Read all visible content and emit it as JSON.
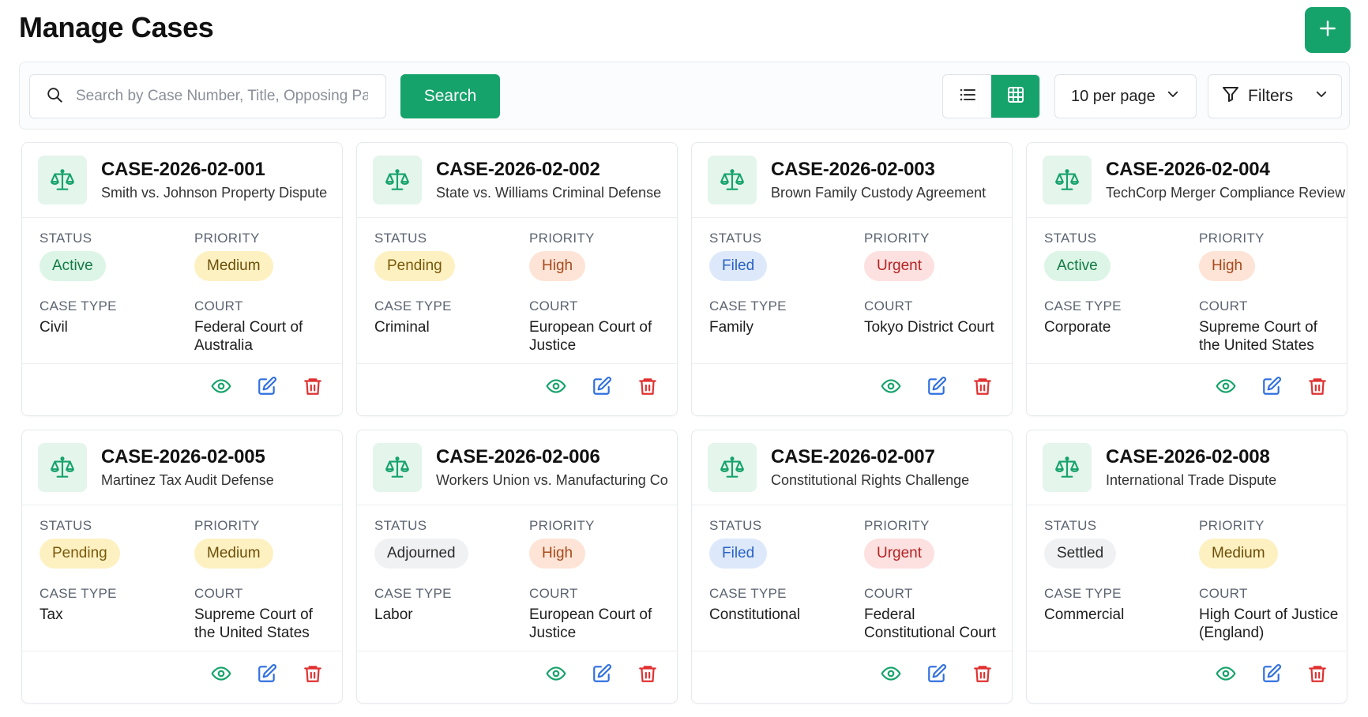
{
  "header": {
    "title": "Manage Cases",
    "add_icon": "plus-icon"
  },
  "toolbar": {
    "search_placeholder": "Search by Case Number, Title, Opposing Pa...",
    "search_label": "Search",
    "view_modes": [
      "list",
      "grid"
    ],
    "active_view": "grid",
    "per_page": "10 per page",
    "filters_label": "Filters"
  },
  "labels": {
    "status": "STATUS",
    "priority": "PRIORITY",
    "case_type": "CASE TYPE",
    "court": "COURT"
  },
  "badge_colors": {
    "Active": {
      "bg": "#dcf5e6",
      "fg": "#137a45"
    },
    "Pending": {
      "bg": "#fdf1c2",
      "fg": "#7a5a0a"
    },
    "Filed": {
      "bg": "#dde9fb",
      "fg": "#2a62c4"
    },
    "Adjourned": {
      "bg": "#f0f1f3",
      "fg": "#2b2b2b"
    },
    "Settled": {
      "bg": "#f0f1f3",
      "fg": "#2b2b2b"
    },
    "Medium": {
      "bg": "#fdf1c2",
      "fg": "#6b4e08"
    },
    "High": {
      "bg": "#fde4d6",
      "fg": "#a84a1c"
    },
    "Urgent": {
      "bg": "#fde0e0",
      "fg": "#b42323"
    }
  },
  "cases": [
    {
      "number": "CASE-2026-02-001",
      "title": "Smith vs. Johnson Property Dispute",
      "status": "Active",
      "priority": "Medium",
      "case_type": "Civil",
      "court": "Federal Court of Australia"
    },
    {
      "number": "CASE-2026-02-002",
      "title": "State vs. Williams Criminal Defense",
      "status": "Pending",
      "priority": "High",
      "case_type": "Criminal",
      "court": "European Court of Justice"
    },
    {
      "number": "CASE-2026-02-003",
      "title": "Brown Family Custody Agreement",
      "status": "Filed",
      "priority": "Urgent",
      "case_type": "Family",
      "court": "Tokyo District Court"
    },
    {
      "number": "CASE-2026-02-004",
      "title": "TechCorp Merger Compliance Review",
      "status": "Active",
      "priority": "High",
      "case_type": "Corporate",
      "court": "Supreme Court of the United States"
    },
    {
      "number": "CASE-2026-02-005",
      "title": "Martinez Tax Audit Defense",
      "status": "Pending",
      "priority": "Medium",
      "case_type": "Tax",
      "court": "Supreme Court of the United States"
    },
    {
      "number": "CASE-2026-02-006",
      "title": "Workers Union vs. Manufacturing Co",
      "status": "Adjourned",
      "priority": "High",
      "case_type": "Labor",
      "court": "European Court of Justice"
    },
    {
      "number": "CASE-2026-02-007",
      "title": "Constitutional Rights Challenge",
      "status": "Filed",
      "priority": "Urgent",
      "case_type": "Constitutional",
      "court": "Federal Constitutional Court"
    },
    {
      "number": "CASE-2026-02-008",
      "title": "International Trade Dispute",
      "status": "Settled",
      "priority": "Medium",
      "case_type": "Commercial",
      "court": "High Court of Justice (England)"
    }
  ],
  "card_icons": {
    "case": "scales-icon",
    "view": "eye-icon",
    "edit": "edit-icon",
    "delete": "trash-icon"
  },
  "colors": {
    "accent": "#16a36b",
    "view": "#16a36b",
    "edit": "#2f6fe0",
    "delete": "#e03131"
  }
}
